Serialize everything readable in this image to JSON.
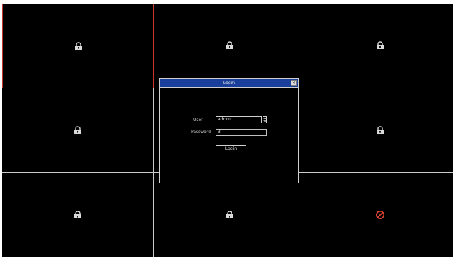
{
  "grid": {
    "cells": [
      {
        "icon": "camera-icon",
        "selected": true
      },
      {
        "icon": "camera-icon",
        "selected": false
      },
      {
        "icon": "camera-icon",
        "selected": false
      },
      {
        "icon": "camera-icon",
        "selected": false
      },
      {
        "icon": "camera-icon",
        "selected": false
      },
      {
        "icon": "camera-icon",
        "selected": false
      },
      {
        "icon": "camera-icon",
        "selected": false
      },
      {
        "icon": "camera-icon",
        "selected": false
      },
      {
        "icon": "no-signal-icon",
        "selected": false
      }
    ],
    "colors": {
      "background": "#000000",
      "divider": "#c9c9c9",
      "selected_border": "#c0392b",
      "no_signal": "#e1442f"
    }
  },
  "login_dialog": {
    "title": "Login",
    "close_icon": "close-icon",
    "user_label": "User",
    "user_value": "admin",
    "password_label": "Password",
    "password_value": "3",
    "login_button": "Login",
    "colors": {
      "titlebar": "#1a3f9b",
      "border": "#cfcfcf",
      "text": "#e6e6e6"
    }
  }
}
